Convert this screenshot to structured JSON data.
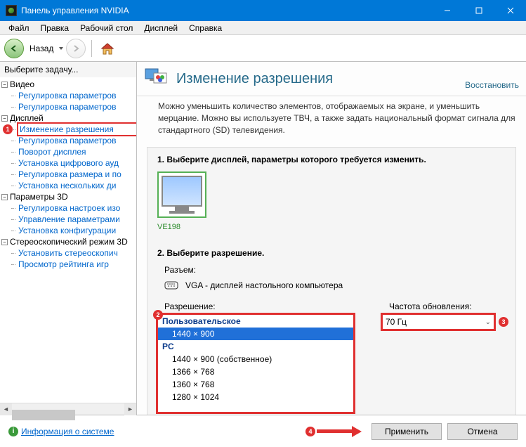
{
  "window": {
    "title": "Панель управления NVIDIA"
  },
  "menu": [
    "Файл",
    "Правка",
    "Рабочий стол",
    "Дисплей",
    "Справка"
  ],
  "toolbar": {
    "back": "Назад"
  },
  "sidebar": {
    "title": "Выберите задачу...",
    "groups": [
      {
        "label": "Видео",
        "items": [
          "Регулировка параметров",
          "Регулировка параметров"
        ]
      },
      {
        "label": "Дисплей",
        "items": [
          "Изменение разрешения",
          "Регулировка параметров",
          "Поворот дисплея",
          "Установка цифрового ауд",
          "Регулировка размера и по",
          "Установка нескольких ди"
        ]
      },
      {
        "label": "Параметры 3D",
        "items": [
          "Регулировка настроек изо",
          "Управление параметрами",
          "Установка конфигурации"
        ]
      },
      {
        "label": "Стереоскопический режим 3D",
        "items": [
          "Установить стереоскопич",
          "Просмотр рейтинга игр"
        ]
      }
    ],
    "selected": "Изменение разрешения"
  },
  "content": {
    "heading": "Изменение разрешения",
    "restore": "Восстановить",
    "description": "Можно уменьшить количество элементов, отображаемых на экране, и уменьшить мерцание. Можно вы используете ТВЧ, а также задать национальный формат сигнала для стандартного (SD) телевидения.",
    "step1_title": "1. Выберите дисплей, параметры которого требуется изменить.",
    "display_name": "VE198",
    "step2_title": "2. Выберите разрешение.",
    "connector_label": "Разъем:",
    "connector_value": "VGA - дисплей настольного компьютера",
    "resolution_label": "Разрешение:",
    "refresh_label": "Частота обновления:",
    "refresh_value": "70 Гц",
    "res_groups": [
      {
        "name": "Пользовательское",
        "items": [
          "1440 × 900"
        ]
      },
      {
        "name": "PC",
        "items": [
          "1440 × 900 (собственное)",
          "1366 × 768",
          "1360 × 768",
          "1280 × 1024"
        ]
      }
    ],
    "res_selected": "1440 × 900"
  },
  "footer": {
    "sysinfo": "Информация о системе",
    "apply": "Применить",
    "cancel": "Отмена"
  },
  "callouts": [
    "1",
    "2",
    "3",
    "4"
  ]
}
